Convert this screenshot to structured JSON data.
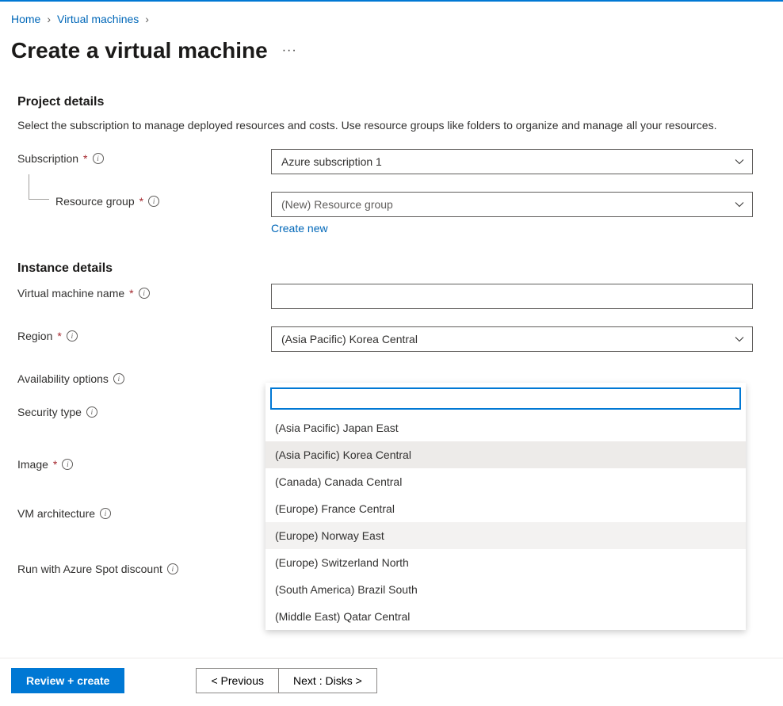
{
  "breadcrumb": {
    "items": [
      {
        "label": "Home"
      },
      {
        "label": "Virtual machines"
      }
    ]
  },
  "page": {
    "title": "Create a virtual machine"
  },
  "project_details": {
    "title": "Project details",
    "description": "Select the subscription to manage deployed resources and costs. Use resource groups like folders to organize and manage all your resources.",
    "subscription_label": "Subscription",
    "subscription_value": "Azure subscription 1",
    "resource_group_label": "Resource group",
    "resource_group_value": "(New) Resource group",
    "create_new_link": "Create new"
  },
  "instance_details": {
    "title": "Instance details",
    "vm_name_label": "Virtual machine name",
    "vm_name_value": "",
    "region_label": "Region",
    "region_value": "(Asia Pacific) Korea Central",
    "availability_label": "Availability options",
    "security_label": "Security type",
    "image_label": "Image",
    "architecture_label": "VM architecture",
    "spot_label": "Run with Azure Spot discount"
  },
  "region_dropdown": {
    "search_value": "",
    "options": [
      {
        "label": "(Asia Pacific) Japan East",
        "state": ""
      },
      {
        "label": "(Asia Pacific) Korea Central",
        "state": "selected"
      },
      {
        "label": "(Canada) Canada Central",
        "state": ""
      },
      {
        "label": "(Europe) France Central",
        "state": ""
      },
      {
        "label": "(Europe) Norway East",
        "state": "hovered"
      },
      {
        "label": "(Europe) Switzerland North",
        "state": ""
      },
      {
        "label": "(South America) Brazil South",
        "state": ""
      },
      {
        "label": "(Middle East) Qatar Central",
        "state": ""
      }
    ]
  },
  "footer": {
    "review_label": "Review + create",
    "previous_label": "< Previous",
    "next_label": "Next : Disks >"
  }
}
